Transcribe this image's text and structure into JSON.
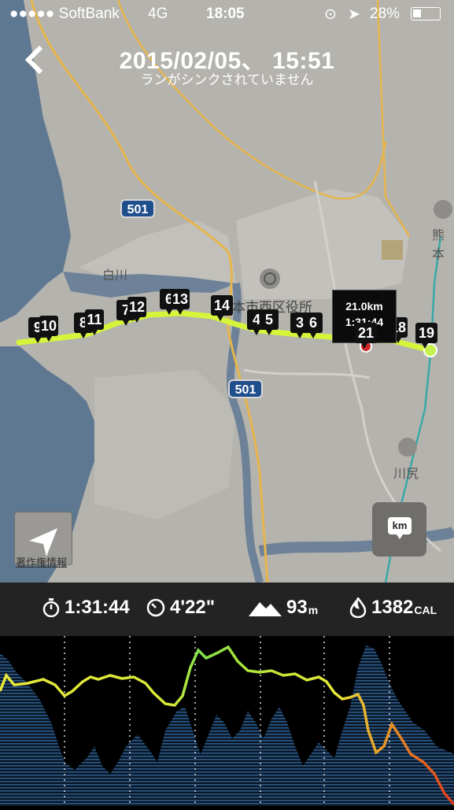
{
  "status_bar": {
    "carrier": "●●●●● SoftBank",
    "network": "4G",
    "time": "18:05",
    "battery": "28%"
  },
  "header": {
    "title": "2015/02/05、 15:51",
    "subtitle": "ランがシンクされていません"
  },
  "map": {
    "labels": {
      "river": "白川",
      "ward_office": "本市西区役所",
      "station1": "熊本",
      "station2": "川尻"
    },
    "road_number": "501",
    "credit": "著作権情報",
    "km_button": "km",
    "markers": [
      "9",
      "10",
      "8",
      "11",
      "7",
      "12",
      "6",
      "13",
      "14",
      "4",
      "5",
      "3",
      "6",
      "21",
      "18",
      "19"
    ],
    "tooltip": {
      "distance": "21.0km",
      "time": "1:31:44"
    },
    "route_color": "#d6f53a"
  },
  "stats": {
    "duration": "1:31:44",
    "pace": "4'22\"",
    "elevation": "93",
    "elevation_unit": "m",
    "calories": "1382",
    "calories_unit": "CAL"
  },
  "colors": {
    "pace_fast": "#7ee04a",
    "pace_mid": "#e8e83a",
    "pace_slow": "#e85a1e",
    "elevation_fill": "#24466e"
  }
}
